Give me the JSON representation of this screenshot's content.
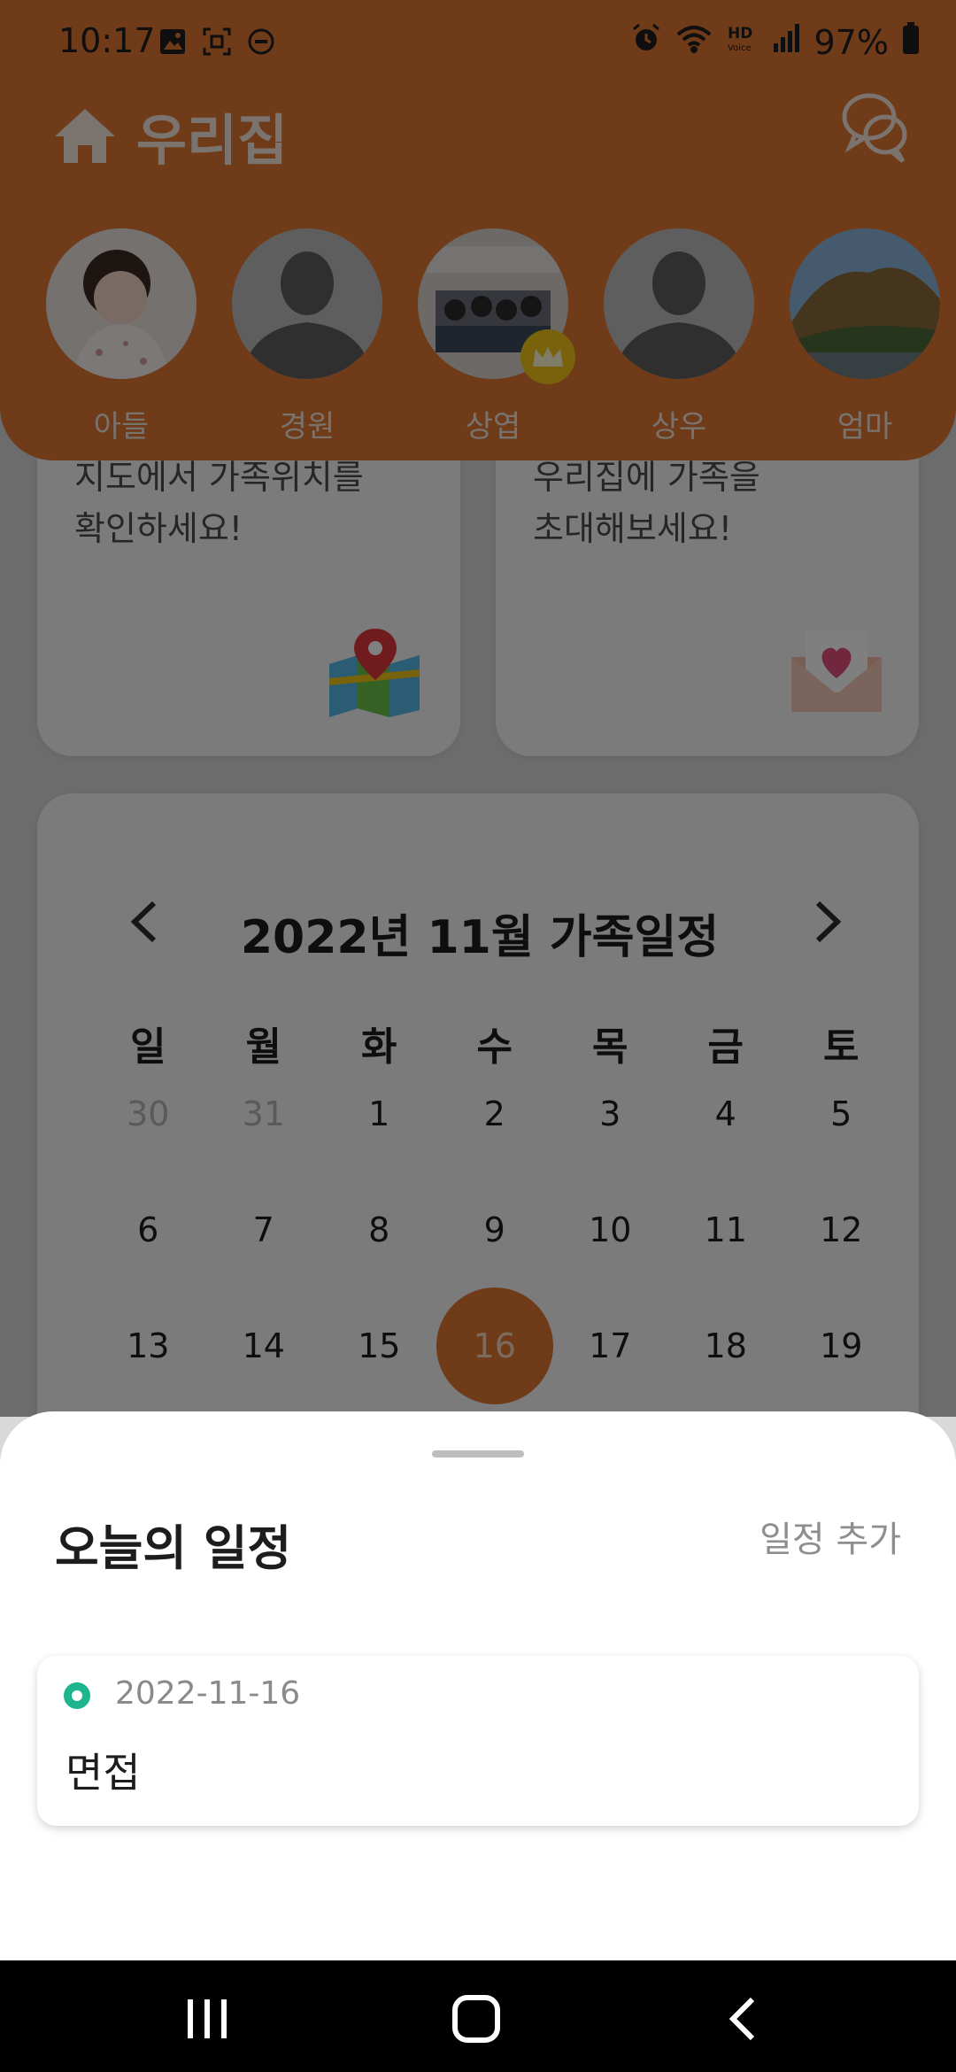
{
  "status": {
    "time": "10:17",
    "battery": "97%",
    "left_icons": [
      "gallery-icon",
      "screenshot-icon",
      "dnd-icon"
    ],
    "right_icons": [
      "alarm-icon",
      "wifi-icon",
      "hd-voice-icon",
      "signal-icon",
      "battery-icon"
    ]
  },
  "header": {
    "title": "우리집",
    "home_icon": "home-icon",
    "chat_icon": "chat-icon",
    "accent": "#df7632"
  },
  "members": [
    {
      "name": "아들"
    },
    {
      "name": "경원"
    },
    {
      "name": "상엽",
      "badge": "crown-icon"
    },
    {
      "name": "상우"
    },
    {
      "name": "엄마"
    }
  ],
  "cards": {
    "map": {
      "line1": "지도에서 가족위치를",
      "line2": "확인하세요!",
      "icon": "map-pin-icon"
    },
    "invite": {
      "line1": "우리집에 가족을",
      "line2": "초대해보세요!",
      "icon": "invite-letter-icon"
    }
  },
  "calendar": {
    "title": "2022년 11월 가족일정",
    "weekdays": [
      "일",
      "월",
      "화",
      "수",
      "목",
      "금",
      "토"
    ],
    "weeks": [
      [
        "30",
        "31",
        "1",
        "2",
        "3",
        "4",
        "5"
      ],
      [
        "6",
        "7",
        "8",
        "9",
        "10",
        "11",
        "12"
      ],
      [
        "13",
        "14",
        "15",
        "16",
        "17",
        "18",
        "19"
      ]
    ],
    "dim_days": [
      "30",
      "31"
    ],
    "today": "16"
  },
  "sheet": {
    "title": "오늘의 일정",
    "add_label": "일정 추가",
    "event": {
      "date": "2022-11-16",
      "title": "면접",
      "dot_color": "#1db58e"
    }
  },
  "navbar": {
    "icons": [
      "recent-apps-icon",
      "home-button-icon",
      "back-icon"
    ]
  }
}
